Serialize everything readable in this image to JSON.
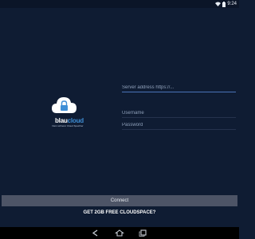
{
  "status_bar": {
    "time": "9:24",
    "icons": [
      "wifi-icon",
      "battery-icon"
    ]
  },
  "logo": {
    "wordmark_part1": "blau",
    "wordmark_part2": "cloud",
    "tagline": "Dein sicherer Cloud Speicher",
    "colors": {
      "cloud": "#ffffff",
      "accent": "#3f8fd6"
    }
  },
  "form": {
    "server": {
      "placeholder": "Server address https://...",
      "value": ""
    },
    "username": {
      "placeholder": "Username",
      "value": ""
    },
    "password": {
      "placeholder": "Password",
      "value": ""
    }
  },
  "connect_button": {
    "label": "Connect"
  },
  "signup_link": {
    "label": "GET 2GB FREE CLOUDSPACE?"
  },
  "nav_bar": {
    "icons": [
      "back-icon",
      "home-icon",
      "recent-apps-icon"
    ]
  },
  "colors": {
    "background": "#0f1c33",
    "active_underline": "#4a73b7",
    "button": "#4d5466"
  }
}
